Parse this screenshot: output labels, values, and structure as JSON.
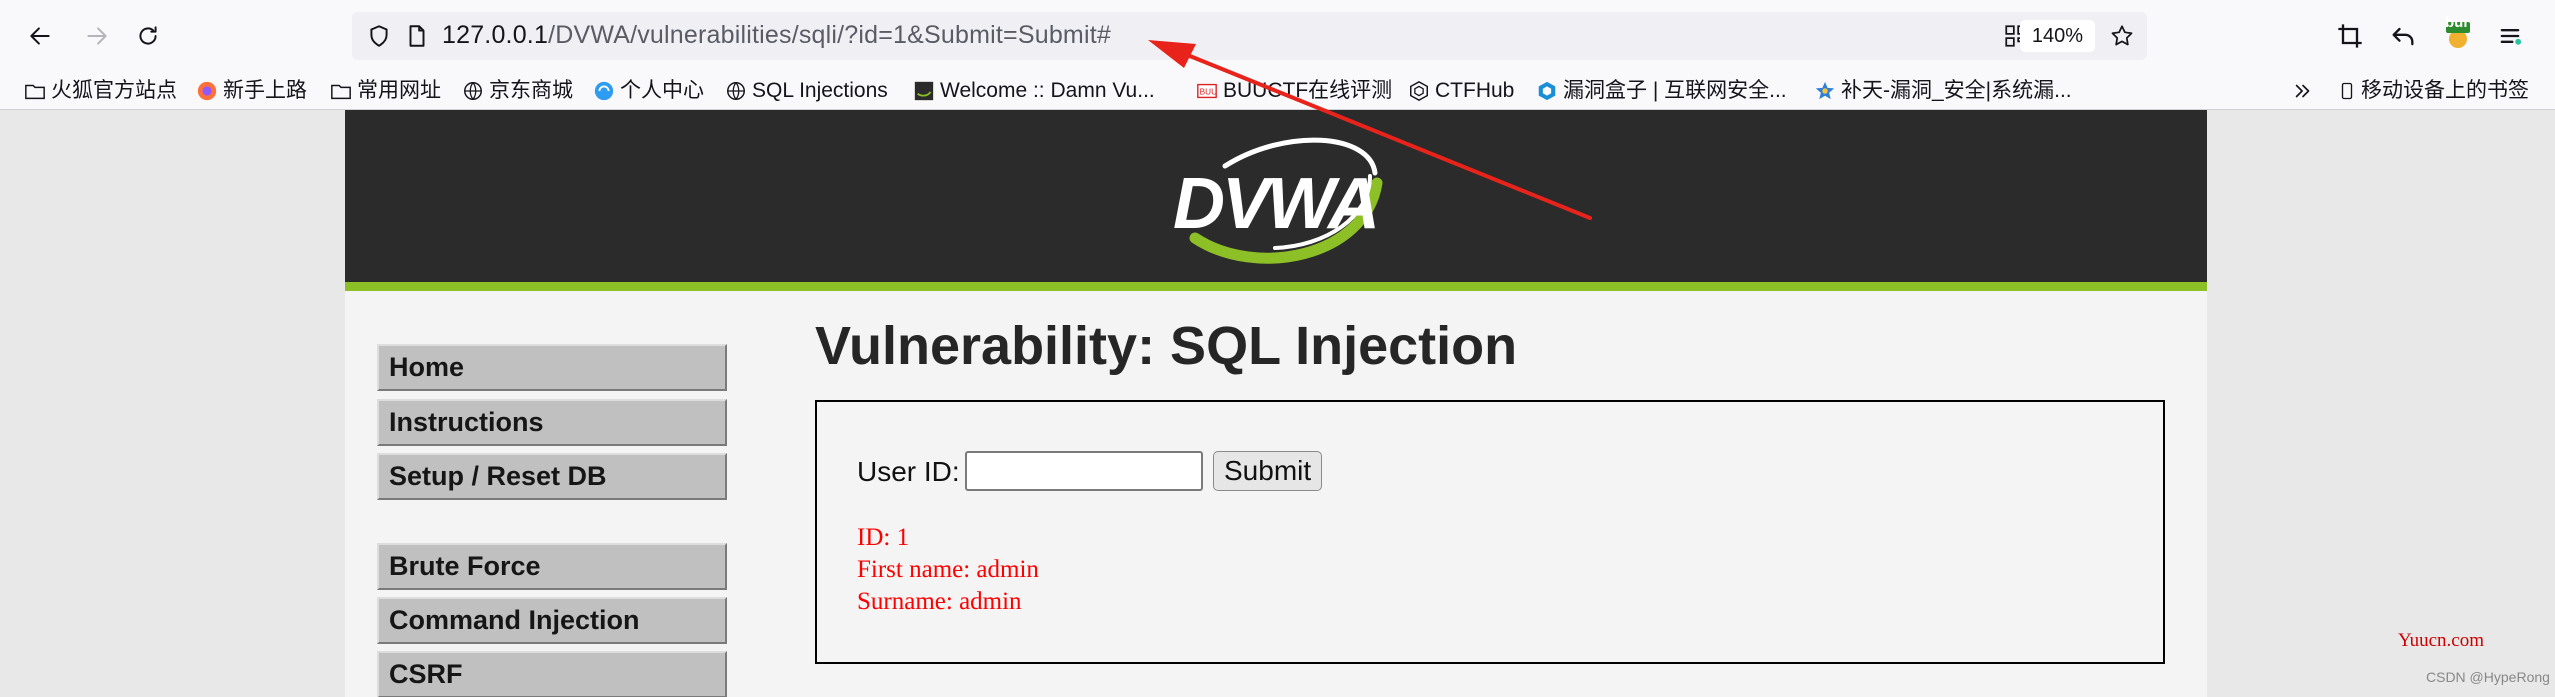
{
  "browser": {
    "url_host": "127.0.0.1",
    "url_path": "/DVWA/vulnerabilities/sqli/?id=1&Submit=Submit#",
    "zoom": "140%",
    "bookmarks": [
      {
        "label": "火狐官方站点",
        "icon": "folder-icon"
      },
      {
        "label": "新手上路",
        "icon": "firefox-icon"
      },
      {
        "label": "常用网址",
        "icon": "folder-icon"
      },
      {
        "label": "京东商城",
        "icon": "globe-icon"
      },
      {
        "label": "个人中心",
        "icon": "profile-icon"
      },
      {
        "label": "SQL Injections",
        "icon": "globe-icon"
      },
      {
        "label": "Welcome :: Damn Vu...",
        "icon": "dvwa-icon"
      },
      {
        "label": "BUUCTF在线评测",
        "icon": "buu-icon"
      },
      {
        "label": "CTFHub",
        "icon": "ctfhub-icon"
      },
      {
        "label": "漏洞盒子 | 互联网安全...",
        "icon": "vulbox-icon"
      },
      {
        "label": "补天-漏洞_安全|系统漏...",
        "icon": "butian-icon"
      }
    ],
    "mobile_bookmarks": "移动设备上的书签",
    "extension_badge": "bur"
  },
  "dvwa": {
    "logo_text": "DVWA",
    "menu": [
      "Home",
      "Instructions",
      "Setup / Reset DB",
      "Brute Force",
      "Command Injection",
      "CSRF"
    ],
    "page_title": "Vulnerability: SQL Injection",
    "form": {
      "user_id_label": "User ID:",
      "user_id_value": "",
      "submit_label": "Submit"
    },
    "result": {
      "id": "ID: 1",
      "first_name": "First name: admin",
      "surname": "Surname: admin"
    }
  },
  "watermarks": {
    "site": "Yuucn.com",
    "author": "CSDN @HypeRong"
  },
  "colors": {
    "header_bg": "#2b2b2b",
    "accent_green": "#8dbf26",
    "result_red": "#ff0000",
    "annotation_arrow": "#e8231b"
  }
}
